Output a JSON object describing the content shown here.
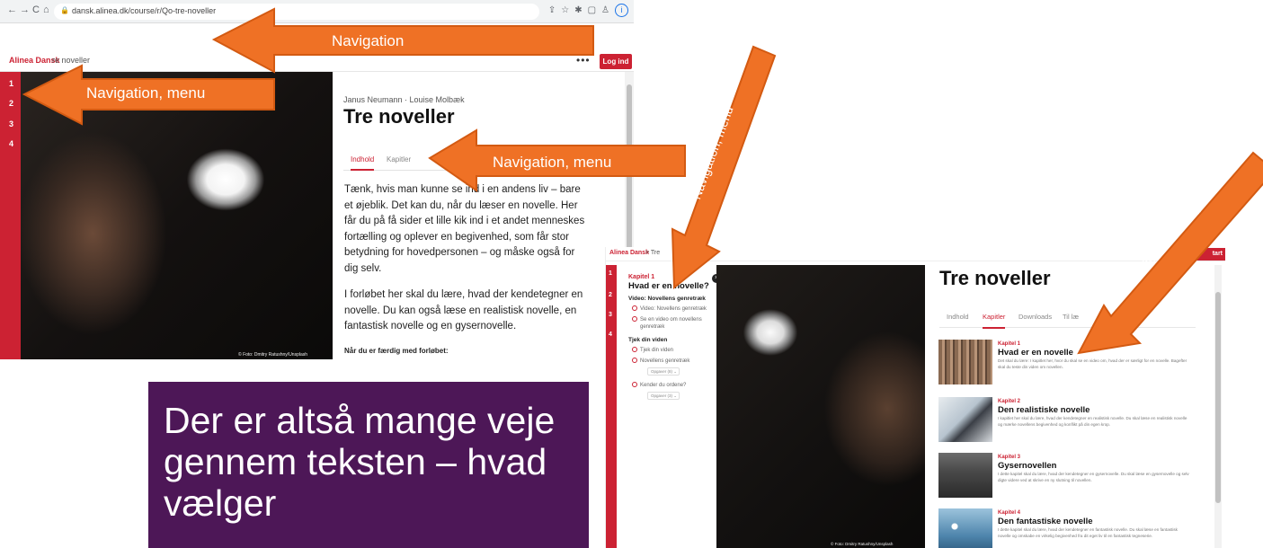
{
  "left_shot": {
    "browser": {
      "back": "←",
      "forward": "→",
      "reload": "C",
      "home": "⌂",
      "url": "dansk.alinea.dk/course/r/Qo-tre-noveller"
    },
    "appbar": {
      "logo": "Alinea Dansk",
      "breadcrumb": "re noveller",
      "more": "•••",
      "login": "Log ind"
    },
    "rail": [
      "1",
      "2",
      "3",
      "4"
    ],
    "photo_credit": "© Foto: Dmitry Ratushny/Unsplash",
    "authors": "Janus Neumann · Louise Molbæk",
    "title": "Tre noveller",
    "tabs": {
      "active": "Indhold",
      "inactive": "Kapitler"
    },
    "paragraph1": "Tænk, hvis man kunne se ind i en andens liv – bare et øjeblik. Det kan du, når du læser en novelle. Her får du på få sider et lille kik ind i et andet menneskes fortælling og oplever en begivenhed, som får stor betydning for hovedpersonen – og måske også for dig selv.",
    "paragraph2": "I forløbet her skal du lære, hvad der kendetegner en novelle. Du kan også læse en realistisk novelle, en fantastisk novelle og en gysernovelle.",
    "bold_line": "Når du er færdig med forløbet:"
  },
  "purple_box": {
    "text": "Der er altså mange veje gennem teksten – hvad vælger"
  },
  "right_shot": {
    "appbar": {
      "logo": "Alinea Dansk",
      "breadcrumb": "> Tre",
      "start": "tart"
    },
    "rail": [
      "1",
      "2",
      "3",
      "4"
    ],
    "menu": {
      "kapitel": "Kapitel 1",
      "title": "Hvad er en novelle?",
      "close": "×",
      "section1": "Video: Novellens genretræk",
      "item1": "Video: Novellens genretræk",
      "item2": "Se en video om novellens genretræk",
      "section2": "Tjek din viden",
      "item3": "Tjek din viden",
      "item4": "Novellens genretræk",
      "opgaver1": "Opgaver (8) ⌄",
      "item5": "Kender du ordene?",
      "opgaver2": "Opgaver (3) ⌄"
    },
    "photo_credit": "© Foto: Dmitry Ratushny/Unsplash",
    "title": "Tre noveller",
    "tabs": [
      "Indhold",
      "Kapitler",
      "Downloads",
      "Til læ"
    ],
    "active_tab": "Kapitler",
    "chapters": [
      {
        "kapitel": "Kapitel 1",
        "title": "Hvad er en novelle",
        "desc": "Det skal du lære: I kapitlet her, hvor du skal se en video om, hvad der er særligt for en novelle. Bagefter skal du teste din viden om novellen."
      },
      {
        "kapitel": "Kapitel 2",
        "title": "Den realistiske novelle",
        "desc": "I kapitlet her skal du lære, hvad der kendetegner en realistisk novelle. Du skal læse en realistisk novelle og mærke novellens begivenhed og konflikt på din egen krop."
      },
      {
        "kapitel": "Kapitel 3",
        "title": "Gysernovellen",
        "desc": "I dette kapitel skal du lære, hvad der kendetegner en gysernovelle. Du skal læse en gysernovelle og selv digte videre ved at skrive en ny slutning til novellen."
      },
      {
        "kapitel": "Kapitel 4",
        "title": "Den fantastiske novelle",
        "desc": "I dette kapitel skal du lære, hvad der kendetegner en fantastisk novelle. Du skal læse en fantastisk novelle og omskabe en virkelig begivenhed fra dit eget liv til en fantastisk tegneserie."
      }
    ]
  },
  "annotations": {
    "arrow_top": "Navigation",
    "arrow_menu": "Navigation, menu",
    "arrow_tabs": "Navigation, menu",
    "arrow_diag1": "Navigation, menu",
    "arrow_diag2": "Navigation, menu",
    "arrow_color": "#ef7125",
    "arrow_border": "#d35a12"
  },
  "colors": {
    "brand_red": "#cc2233",
    "purple": "#4d1757"
  }
}
